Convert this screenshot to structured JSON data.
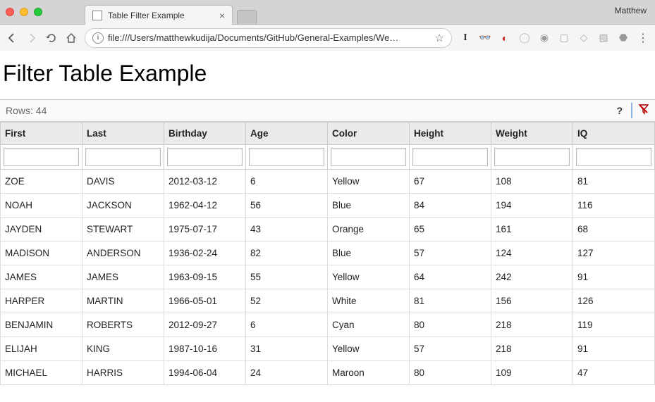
{
  "browser": {
    "user": "Matthew",
    "tab_title": "Table Filter Example",
    "url": "file:///Users/matthewkudija/Documents/GitHub/General-Examples/We…"
  },
  "page": {
    "title": "Filter Table Example"
  },
  "status": {
    "rows_label": "Rows: 44",
    "help": "?"
  },
  "table": {
    "columns": [
      "First",
      "Last",
      "Birthday",
      "Age",
      "Color",
      "Height",
      "Weight",
      "IQ"
    ],
    "rows": [
      {
        "first": "ZOE",
        "last": "DAVIS",
        "birthday": "2012-03-12",
        "age": "6",
        "color": "Yellow",
        "height": "67",
        "weight": "108",
        "iq": "81"
      },
      {
        "first": "NOAH",
        "last": "JACKSON",
        "birthday": "1962-04-12",
        "age": "56",
        "color": "Blue",
        "height": "84",
        "weight": "194",
        "iq": "116"
      },
      {
        "first": "JAYDEN",
        "last": "STEWART",
        "birthday": "1975-07-17",
        "age": "43",
        "color": "Orange",
        "height": "65",
        "weight": "161",
        "iq": "68"
      },
      {
        "first": "MADISON",
        "last": "ANDERSON",
        "birthday": "1936-02-24",
        "age": "82",
        "color": "Blue",
        "height": "57",
        "weight": "124",
        "iq": "127"
      },
      {
        "first": "JAMES",
        "last": "JAMES",
        "birthday": "1963-09-15",
        "age": "55",
        "color": "Yellow",
        "height": "64",
        "weight": "242",
        "iq": "91"
      },
      {
        "first": "HARPER",
        "last": "MARTIN",
        "birthday": "1966-05-01",
        "age": "52",
        "color": "White",
        "height": "81",
        "weight": "156",
        "iq": "126"
      },
      {
        "first": "BENJAMIN",
        "last": "ROBERTS",
        "birthday": "2012-09-27",
        "age": "6",
        "color": "Cyan",
        "height": "80",
        "weight": "218",
        "iq": "119"
      },
      {
        "first": "ELIJAH",
        "last": "KING",
        "birthday": "1987-10-16",
        "age": "31",
        "color": "Yellow",
        "height": "57",
        "weight": "218",
        "iq": "91"
      },
      {
        "first": "MICHAEL",
        "last": "HARRIS",
        "birthday": "1994-06-04",
        "age": "24",
        "color": "Maroon",
        "height": "80",
        "weight": "109",
        "iq": "47"
      }
    ]
  }
}
